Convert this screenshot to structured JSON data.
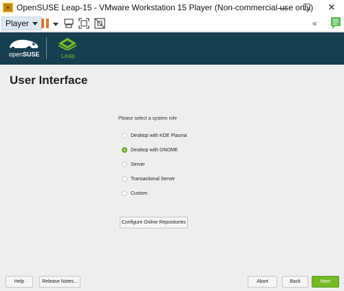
{
  "window": {
    "title": "OpenSUSE Leap-15 - VMware Workstation 15 Player (Non-commercial use only)",
    "minimize_glyph": "—",
    "maximize_glyph": "☐",
    "close_glyph": "✕"
  },
  "toolbar": {
    "player_label": "Player",
    "back_glyph": "«",
    "icons": [
      "vmware-app-icon",
      "pause-icon",
      "send-keys-icon",
      "fullscreen-icon",
      "unity-icon",
      "collapse-toolbar-icon",
      "message-icon"
    ]
  },
  "banner": {
    "brand_prefix": "open",
    "brand_suffix": "SUSE",
    "product": "Leap"
  },
  "installer": {
    "title": "User Interface",
    "prompt": "Please select a system role",
    "roles": [
      {
        "label": "Desktop with KDE Plasma",
        "selected": false
      },
      {
        "label": "Desktop with GNOME",
        "selected": true
      },
      {
        "label": "Server",
        "selected": false
      },
      {
        "label": "Transactional Server",
        "selected": false
      },
      {
        "label": "Custom",
        "selected": false
      }
    ],
    "configure_repos_label": "Configure Online Repositories"
  },
  "footer": {
    "help": "Help",
    "release_notes": "Release Notes...",
    "abort": "Abort",
    "back": "Back",
    "next": "Next"
  },
  "colors": {
    "banner_bg": "#173f4f",
    "accent_green": "#73ba25",
    "pause_orange": "#e8742a",
    "content_bg": "#eeeeee"
  }
}
